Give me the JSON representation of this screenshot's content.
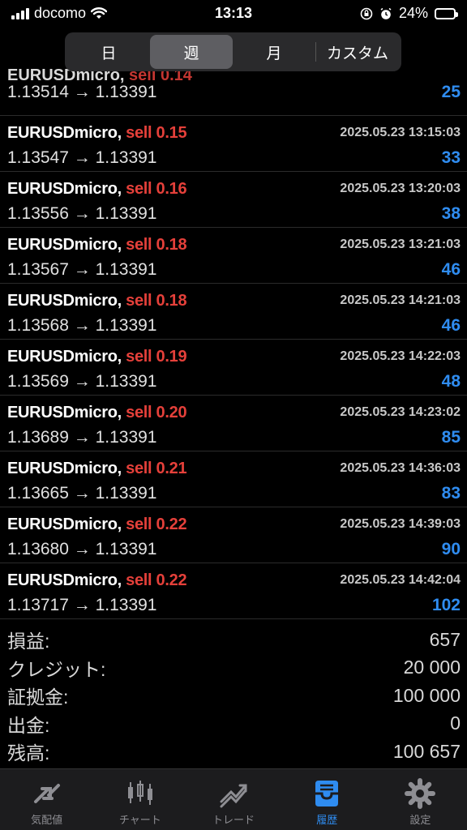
{
  "status": {
    "carrier": "docomo",
    "time": "13:13",
    "battery": "24%",
    "battery_level": 0.24
  },
  "segment": {
    "tabs": [
      {
        "label": "日"
      },
      {
        "label": "週"
      },
      {
        "label": "月"
      },
      {
        "label": "カスタム"
      }
    ],
    "active": 1
  },
  "first_row": {
    "cut_symbol": "EURUSDmicro,",
    "cut_sell": "sell 0.14",
    "prices": "1.13514 → 1.13391",
    "profit": "25"
  },
  "trades": [
    {
      "symbol": "EURUSDmicro,",
      "sell": "sell 0.15",
      "time": "2025.05.23 13:15:03",
      "prices": "1.13547 → 1.13391",
      "profit": "33"
    },
    {
      "symbol": "EURUSDmicro,",
      "sell": "sell 0.16",
      "time": "2025.05.23 13:20:03",
      "prices": "1.13556 → 1.13391",
      "profit": "38"
    },
    {
      "symbol": "EURUSDmicro,",
      "sell": "sell 0.18",
      "time": "2025.05.23 13:21:03",
      "prices": "1.13567 → 1.13391",
      "profit": "46"
    },
    {
      "symbol": "EURUSDmicro,",
      "sell": "sell 0.18",
      "time": "2025.05.23 14:21:03",
      "prices": "1.13568 → 1.13391",
      "profit": "46"
    },
    {
      "symbol": "EURUSDmicro,",
      "sell": "sell 0.19",
      "time": "2025.05.23 14:22:03",
      "prices": "1.13569 → 1.13391",
      "profit": "48"
    },
    {
      "symbol": "EURUSDmicro,",
      "sell": "sell 0.20",
      "time": "2025.05.23 14:23:02",
      "prices": "1.13689 → 1.13391",
      "profit": "85"
    },
    {
      "symbol": "EURUSDmicro,",
      "sell": "sell 0.21",
      "time": "2025.05.23 14:36:03",
      "prices": "1.13665 → 1.13391",
      "profit": "83"
    },
    {
      "symbol": "EURUSDmicro,",
      "sell": "sell 0.22",
      "time": "2025.05.23 14:39:03",
      "prices": "1.13680 → 1.13391",
      "profit": "90"
    },
    {
      "symbol": "EURUSDmicro,",
      "sell": "sell 0.22",
      "time": "2025.05.23 14:42:04",
      "prices": "1.13717 → 1.13391",
      "profit": "102"
    }
  ],
  "summary": [
    {
      "label": "損益:",
      "value": "657"
    },
    {
      "label": "クレジット:",
      "value": "20 000"
    },
    {
      "label": "証拠金:",
      "value": "100 000"
    },
    {
      "label": "出金:",
      "value": "0"
    },
    {
      "label": "残高:",
      "value": "100 657"
    }
  ],
  "tabbar": [
    {
      "label": "気配値",
      "icon": "quotes-icon"
    },
    {
      "label": "チャート",
      "icon": "chart-icon"
    },
    {
      "label": "トレード",
      "icon": "trade-icon"
    },
    {
      "label": "履歴",
      "icon": "history-icon"
    },
    {
      "label": "設定",
      "icon": "settings-icon"
    }
  ],
  "colors": {
    "sell": "#e5403a",
    "profit": "#2f8cf0",
    "active_tab": "#2f8cf0"
  }
}
